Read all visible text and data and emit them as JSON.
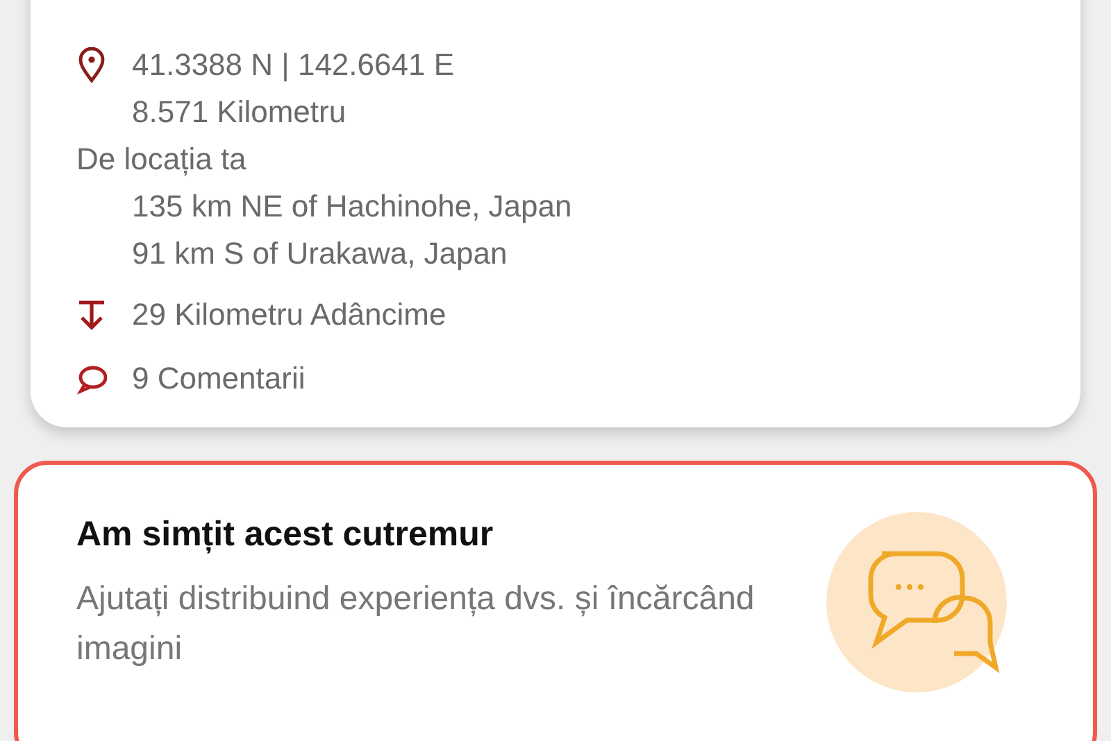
{
  "details": {
    "coordinates": "41.3388 N | 142.6641 E",
    "distance": "8.571 Kilometru",
    "from_label": "De locația ta",
    "nearby": [
      "135 km NE of Hachinohe, Japan",
      "91 km S of Urakawa, Japan"
    ],
    "depth": "29 Kilometru Adâncime",
    "comments": "9 Comentarii"
  },
  "felt_card": {
    "title": "Am simțit acest cutremur",
    "subtitle": "Ajutați distribuind experiența dvs. și încărcând imagini"
  }
}
